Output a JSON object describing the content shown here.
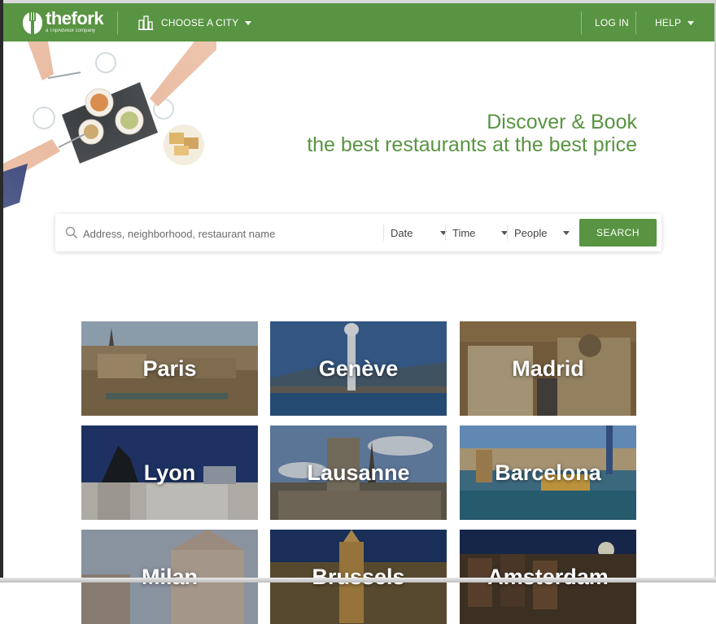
{
  "header": {
    "logo_text": "thefork",
    "logo_subtext": "a TripAdvisor company",
    "city_selector_label": "CHOOSE A CITY",
    "login_label": "LOG IN",
    "help_label": "HELP",
    "color": "#589442"
  },
  "hero": {
    "tagline_line1": "Discover & Book",
    "tagline_line2": "the best restaurants at the best price"
  },
  "search": {
    "placeholder": "Address, neighborhood, restaurant name",
    "date_label": "Date",
    "time_label": "Time",
    "people_label": "People",
    "button_label": "SEARCH"
  },
  "cities": [
    {
      "name": "Paris"
    },
    {
      "name": "Genève"
    },
    {
      "name": "Madrid"
    },
    {
      "name": "Lyon"
    },
    {
      "name": "Lausanne"
    },
    {
      "name": "Barcelona"
    },
    {
      "name": "Milan"
    },
    {
      "name": "Brussels"
    },
    {
      "name": "Amsterdam"
    }
  ]
}
